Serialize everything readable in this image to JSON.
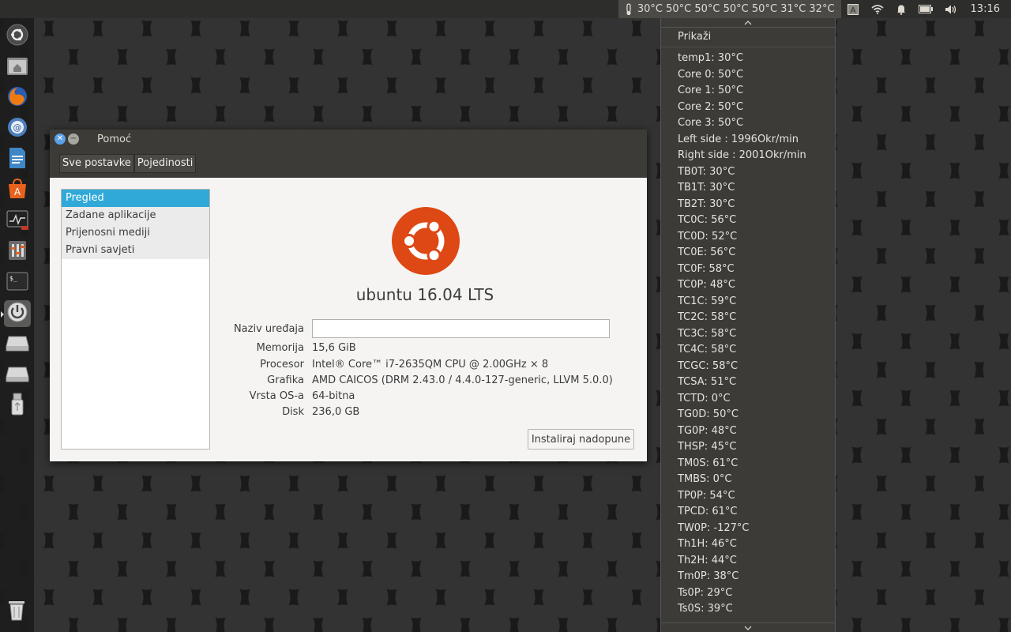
{
  "top_panel": {
    "temps": "30°C 50°C 50°C 50°C 50°C 31°C 32°C",
    "clock": "13:16"
  },
  "launcher": {
    "items": [
      "ubuntu-dash-icon",
      "files-icon",
      "firefox-icon",
      "thunderbird-icon",
      "libreoffice-writer-icon",
      "software-center-icon",
      "system-monitor-icon",
      "system-settings-icon",
      "terminal-icon",
      "power-settings-icon",
      "drive-icon",
      "drive-icon",
      "usb-drive-icon"
    ],
    "trash": "trash-icon"
  },
  "window": {
    "title": "Pomoć",
    "toolbar": {
      "all_settings": "Sve postavke",
      "details": "Pojedinosti"
    },
    "sidebar": [
      "Pregled",
      "Zadane aplikacije",
      "Prijenosni mediji",
      "Pravni savjeti"
    ],
    "os_name": "ubuntu 16.04 LTS",
    "info": {
      "device_name_label": "Naziv uređaja",
      "device_name_value": "",
      "memory_label": "Memorija",
      "memory_value": "15,6 GiB",
      "processor_label": "Procesor",
      "processor_value": "Intel® Core™ i7-2635QM CPU @ 2.00GHz × 8",
      "graphics_label": "Grafika",
      "graphics_value": "AMD CAICOS (DRM 2.43.0 / 4.4.0-127-generic, LLVM 5.0.0)",
      "ostype_label": "Vrsta OS-a",
      "ostype_value": "64-bitna",
      "disk_label": "Disk",
      "disk_value": "236,0 GB"
    },
    "install_button": "Instaliraj nadopune"
  },
  "menu": {
    "show": "Prikaži",
    "items": [
      "temp1: 30°C",
      "Core 0: 50°C",
      "Core 1: 50°C",
      "Core 2: 50°C",
      "Core 3: 50°C",
      "Left side : 1996Okr/min",
      "Right side : 2001Okr/min",
      "TB0T: 30°C",
      "TB1T: 30°C",
      "TB2T: 30°C",
      "TC0C: 56°C",
      "TC0D: 52°C",
      "TC0E: 56°C",
      "TC0F: 58°C",
      "TC0P: 48°C",
      "TC1C: 59°C",
      "TC2C: 58°C",
      "TC3C: 58°C",
      "TC4C: 58°C",
      "TCGC: 58°C",
      "TCSA: 51°C",
      "TCTD: 0°C",
      "TG0D: 50°C",
      "TG0P: 48°C",
      "THSP: 45°C",
      "TM0S: 61°C",
      "TMBS: 0°C",
      "TP0P: 54°C",
      "TPCD: 61°C",
      "TW0P: -127°C",
      "Th1H: 46°C",
      "Th2H: 44°C",
      "Tm0P: 38°C",
      "Ts0P: 29°C",
      "Ts0S: 39°C"
    ]
  }
}
